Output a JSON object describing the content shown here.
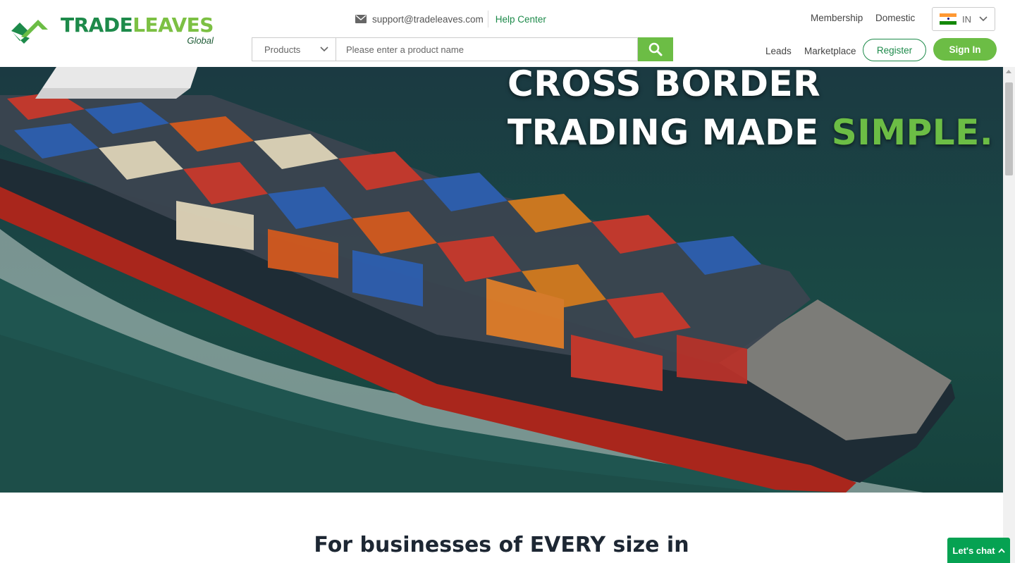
{
  "brand": {
    "name_part1": "TRADE",
    "name_part2": "LEAVES",
    "tagline": "Global",
    "colors": {
      "dark_green": "#1d8a4a",
      "light_green": "#6cbd45"
    }
  },
  "contact": {
    "icon": "mail-icon",
    "email": "support@tradeleaves.com",
    "help_center": "Help Center"
  },
  "search": {
    "category": "Products",
    "placeholder": "Please enter a product name",
    "button_icon": "search-icon"
  },
  "top_nav": {
    "membership": "Membership",
    "domestic": "Domestic",
    "language_code": "IN",
    "flag_icon": "india-flag-icon"
  },
  "main_nav": {
    "leads": "Leads",
    "marketplace": "Marketplace",
    "register": "Register",
    "sign_in": "Sign In"
  },
  "hero": {
    "line1": "CROSS BORDER",
    "line2_prefix": "TRADING MADE ",
    "line2_accent": "SIMPLE."
  },
  "section": {
    "heading": "For businesses of EVERY size in"
  },
  "chat": {
    "label": "Let's chat",
    "icon": "chevron-up-icon"
  }
}
